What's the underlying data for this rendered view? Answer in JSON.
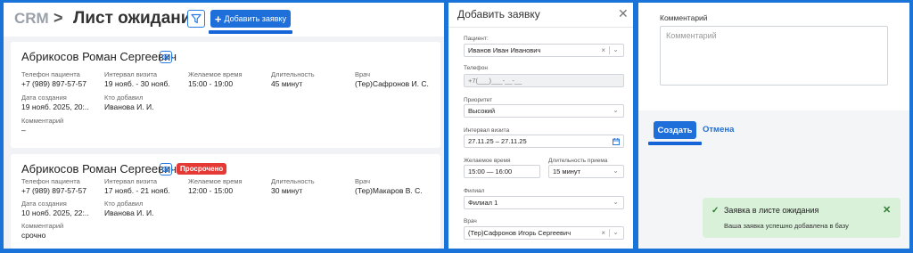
{
  "list_view": {
    "breadcrumb_root": "CRM",
    "breadcrumb_sep": ">",
    "title": "Лист ожидания",
    "add_button": "Добавить заявку",
    "cards": [
      {
        "name": "Абрикосов Роман Сергеевич",
        "badge": "",
        "fields": {
          "phone_label": "Телефон пациента",
          "phone": "+7 (989) 897-57-57",
          "interval_label": "Интервал визита",
          "interval": "19 нояб. - 30 нояб.",
          "time_label": "Желаемое время",
          "time": "15:00 - 19:00",
          "duration_label": "Длительность",
          "duration": "45 минут",
          "doctor_label": "Врач",
          "doctor": "(Тер)Сафронов И. С.",
          "created_label": "Дата создания",
          "created": "19 нояб. 2025, 20:..",
          "author_label": "Кто добавил",
          "author": "Иванова И. И.",
          "comment_label": "Комментарий",
          "comment": "–"
        }
      },
      {
        "name": "Абрикосов Роман Сергеевич",
        "badge": "Просрочено",
        "fields": {
          "phone_label": "Телефон пациента",
          "phone": "+7 (989) 897-57-57",
          "interval_label": "Интервал визита",
          "interval": "17 нояб. - 21 нояб.",
          "time_label": "Желаемое время",
          "time": "12:00 - 15:00",
          "duration_label": "Длительность",
          "duration": "30 минут",
          "doctor_label": "Врач",
          "doctor": "(Тер)Макаров В. С.",
          "created_label": "Дата создания",
          "created": "10 нояб. 2025, 22:..",
          "author_label": "Кто добавил",
          "author": "Иванова И. И.",
          "comment_label": "Комментарий",
          "comment": "срочно"
        }
      }
    ]
  },
  "add_form": {
    "title": "Добавить заявку",
    "close_glyph": "✕",
    "patient_label": "Пациент:",
    "patient_value": "Иванов Иван Иванович",
    "phone_label": "Телефон",
    "phone_placeholder": "+7(___)___-__-__",
    "priority_label": "Приоритет",
    "priority_value": "Высокий",
    "interval_label": "Интервал визита",
    "interval_value": "27.11.25 – 27.11.25",
    "time_label": "Желаемое время",
    "time_value": "15:00 — 16:00",
    "duration_label": "Длительность приема",
    "duration_value": "15 минут",
    "branch_label": "Филиал",
    "branch_value": "Филиал 1",
    "doctor_label": "Врач",
    "doctor_value": "(Тер)Сафронов Игорь Сергеевич"
  },
  "form_bottom": {
    "comment_label": "Комментарий",
    "comment_placeholder": "Комментарий",
    "create_button": "Создать",
    "cancel_link": "Отмена"
  },
  "toast": {
    "title": "Заявка в листе ожидания",
    "message": "Ваша заявка успешно добавлена в базу"
  },
  "colors": {
    "accent": "#1e6fd9",
    "frame": "#1a73d9",
    "danger": "#e53935",
    "success_bg": "#d9f0d9"
  }
}
